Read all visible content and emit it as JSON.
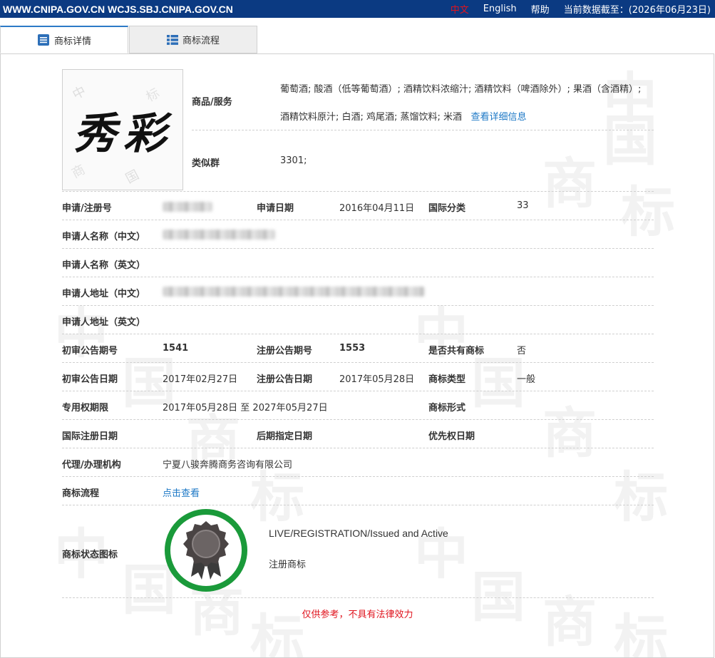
{
  "header": {
    "site": "WWW.CNIPA.GOV.CN WCJS.SBJ.CNIPA.GOV.CN",
    "lang_cn": "中文",
    "lang_en": "English",
    "help": "帮助",
    "data_date": "当前数据截至：(2026年06月23日)"
  },
  "tabs": [
    {
      "label": "商标详情",
      "icon": "detail-list-icon",
      "active": true
    },
    {
      "label": "商标流程",
      "icon": "flow-list-icon",
      "active": false
    }
  ],
  "colors": {
    "topbar": "#0b3a82",
    "tab_accent": "#2d7ac7",
    "link": "#1d78c6",
    "warning": "#e0141e",
    "seal_ring": "#1a9a3a"
  },
  "logo": {
    "text": "秀彩"
  },
  "fields": {
    "goods_label": "商品/服务",
    "goods_value": "葡萄酒; 酸酒（低等葡萄酒）; 酒精饮料浓缩汁; 酒精饮料（啤酒除外）; 果酒（含酒精）; 酒精饮料原汁; 白酒; 鸡尾酒; 蒸馏饮料; 米酒",
    "goods_link": "查看详细信息",
    "similar_group_label": "类似群",
    "similar_group_value": "3301;",
    "reg_no_label": "申请/注册号",
    "app_date_label": "申请日期",
    "app_date_value": "2016年04月11日",
    "intl_class_label": "国际分类",
    "intl_class_value": "33",
    "applicant_cn_label": "申请人名称（中文）",
    "applicant_en_label": "申请人名称（英文）",
    "address_cn_label": "申请人地址（中文）",
    "address_en_label": "申请人地址（英文）",
    "prelim_issue_label": "初审公告期号",
    "prelim_issue_value": "1541",
    "reg_issue_label": "注册公告期号",
    "reg_issue_value": "1553",
    "shared_label": "是否共有商标",
    "shared_value": "否",
    "prelim_date_label": "初审公告日期",
    "prelim_date_value": "2017年02月27日",
    "reg_date_label": "注册公告日期",
    "reg_date_value": "2017年05月28日",
    "mark_type_label": "商标类型",
    "mark_type_value": "一般",
    "exclusive_label": "专用权期限",
    "exclusive_value": "2017年05月28日 至 2027年05月27日",
    "mark_form_label": "商标形式",
    "intl_reg_date_label": "国际注册日期",
    "later_date_label": "后期指定日期",
    "priority_date_label": "优先权日期",
    "agent_label": "代理/办理机构",
    "agent_value": "宁夏八骏奔腾商务咨询有限公司",
    "flow_label": "商标流程",
    "flow_link": "点击查看",
    "status_icon_label": "商标状态图标",
    "status_en": "LIVE/REGISTRATION/Issued and Active",
    "status_cn": "注册商标"
  },
  "watermark": [
    "中",
    "国",
    "商",
    "标"
  ],
  "disclaimer": "仅供参考，不具有法律效力"
}
